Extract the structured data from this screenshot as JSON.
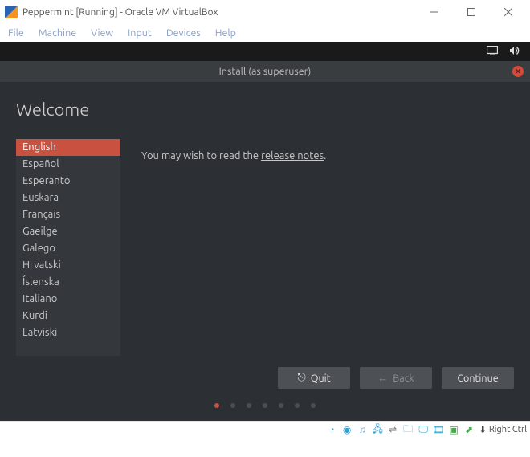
{
  "host": {
    "title": "Peppermint [Running] - Oracle VM VirtualBox",
    "menus": [
      "File",
      "Machine",
      "View",
      "Input",
      "Devices",
      "Help"
    ],
    "status_icons": [
      "hard-disk-icon",
      "optical-drive-icon",
      "audio-icon",
      "network-icon",
      "usb-icon",
      "shared-folders-icon",
      "display-icon",
      "recording-icon",
      "cpu-icon",
      "mouse-integration-icon"
    ],
    "keyboard_hint": "Right Ctrl"
  },
  "guest": {
    "topbar_icons": [
      "display-switch-icon",
      "volume-icon"
    ],
    "dialog_title": "Install (as superuser)",
    "heading": "Welcome",
    "languages": [
      "English",
      "Español",
      "Esperanto",
      "Euskara",
      "Français",
      "Gaeilge",
      "Galego",
      "Hrvatski",
      "Íslenska",
      "Italiano",
      "Kurdî",
      "Latviski"
    ],
    "selected_language_index": 0,
    "note_prefix": "You may wish to read the ",
    "note_link": "release notes",
    "note_suffix": ".",
    "buttons": {
      "quit": "Quit",
      "back": "Back",
      "continue": "Continue"
    },
    "pager": {
      "count": 7,
      "active": 0
    }
  }
}
